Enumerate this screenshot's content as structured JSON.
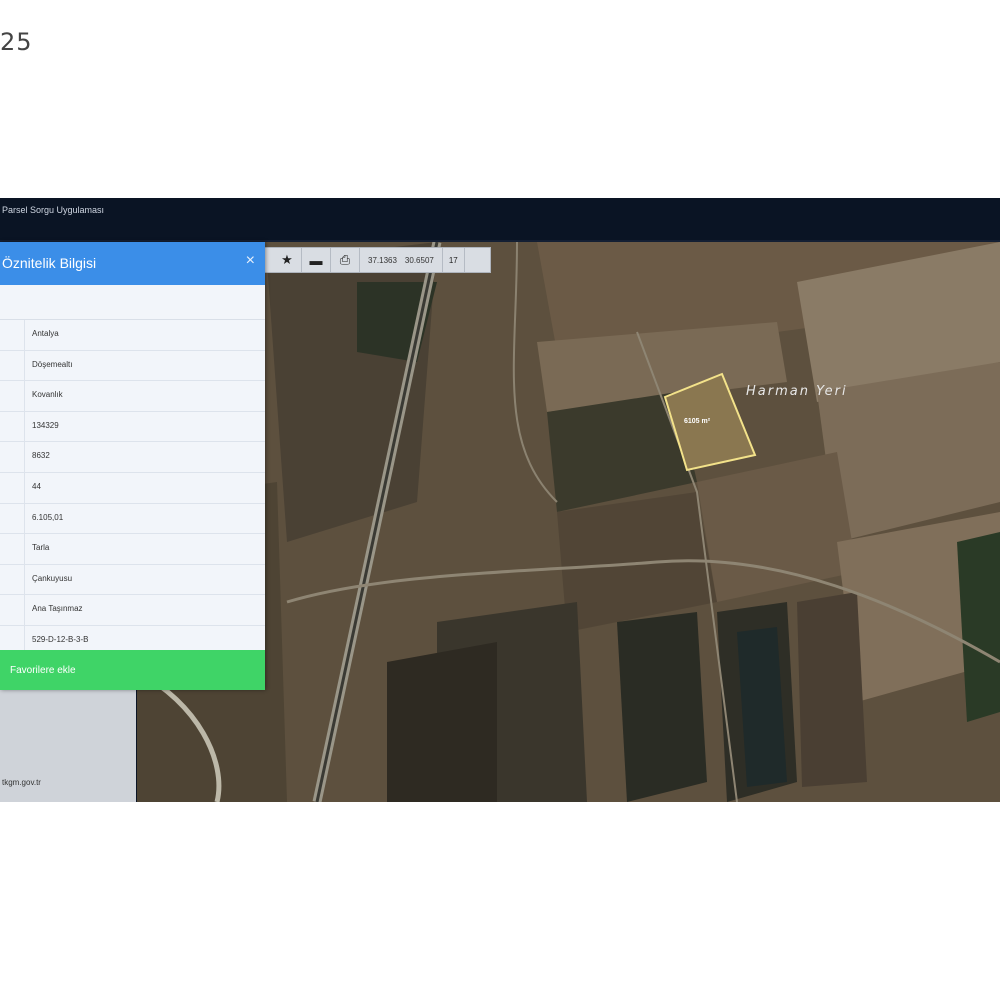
{
  "corner_number": "25",
  "app": {
    "title": "Parsel Sorgu Uygulaması"
  },
  "toolbar": {
    "star_icon": "star-icon",
    "zoom_out_icon": "minus-icon",
    "print_icon": "printer-icon",
    "lat": "37.1363",
    "lon": "30.6507",
    "zoom": "17"
  },
  "panel": {
    "title": "Öznitelik Bilgisi",
    "close_label": "×",
    "rows": [
      {
        "value": "Antalya"
      },
      {
        "value": "Döşemealtı"
      },
      {
        "value": "Kovanlık"
      },
      {
        "value": "134329"
      },
      {
        "value": "8632"
      },
      {
        "value": "44"
      },
      {
        "value": "6.105,01"
      },
      {
        "value": "Tarla"
      },
      {
        "value": "Çankuyusu"
      },
      {
        "value": "Ana Taşınmaz"
      },
      {
        "value": "529-D-12-B-3-B"
      }
    ],
    "favorite_label": "Favorilere ekle"
  },
  "sidebar_footer": "tkgm.gov.tr",
  "map": {
    "parcel_label": "6105 m²",
    "place_label": "Harman Yeri",
    "parcel_outline_color": "#f3e28a"
  }
}
